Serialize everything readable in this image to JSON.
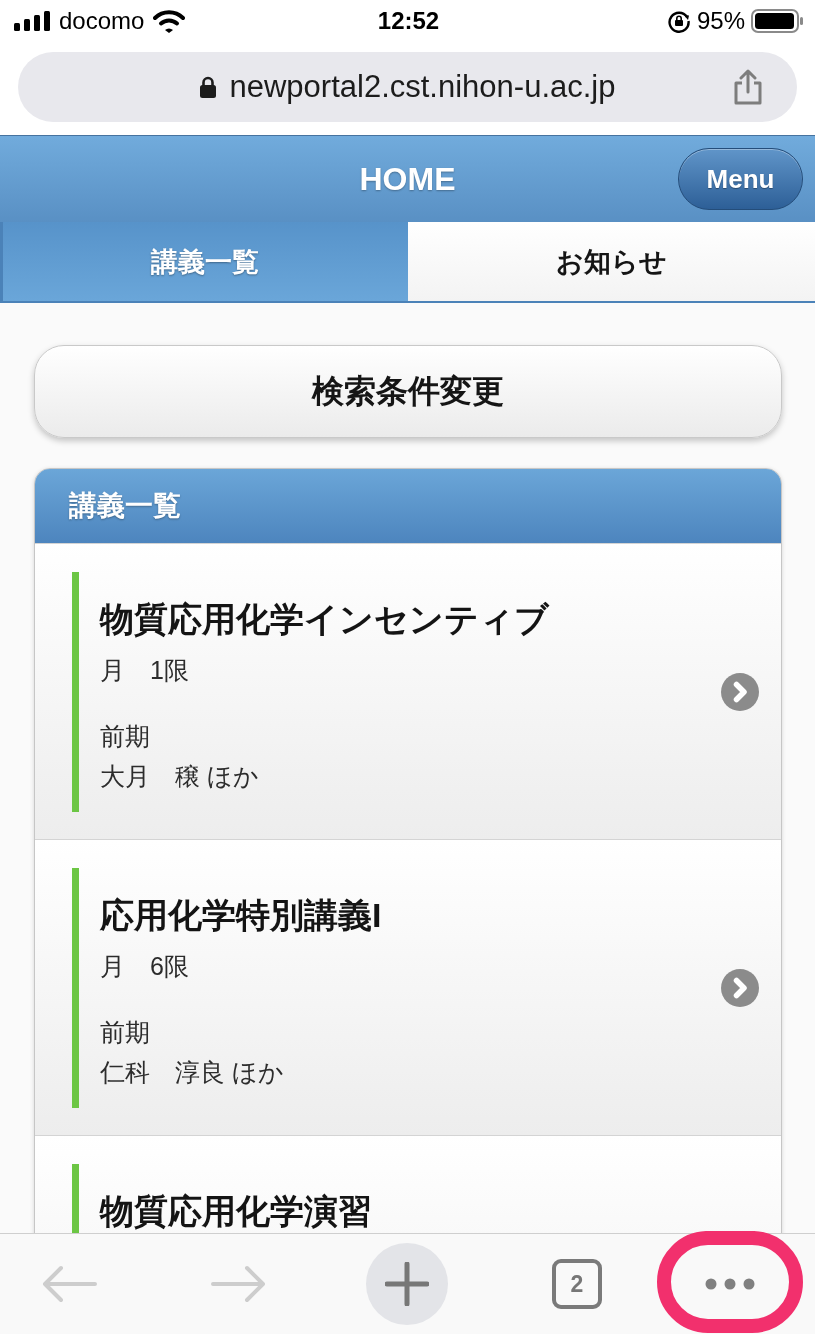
{
  "status_bar": {
    "carrier": "docomo",
    "time": "12:52",
    "battery": "95%"
  },
  "browser": {
    "url": "newportal2.cst.nihon-u.ac.jp"
  },
  "header": {
    "title": "HOME",
    "menu_button": "Menu"
  },
  "tabs": [
    {
      "label": "講義一覧",
      "selected": true
    },
    {
      "label": "お知らせ",
      "selected": false
    }
  ],
  "search_button": "検索条件変更",
  "lecture_list": {
    "title": "講義一覧",
    "items": [
      {
        "title": "物質応用化学インセンティブ",
        "schedule": "月　1限",
        "term": "前期",
        "teacher": "大月　穣 ほか"
      },
      {
        "title": "応用化学特別講義I",
        "schedule": "月　6限",
        "term": "前期",
        "teacher": "仁科　淳良 ほか"
      },
      {
        "title": "物質応用化学演習"
      }
    ]
  },
  "toolbar": {
    "back": {
      "disabled": true
    },
    "forward": {
      "disabled": true
    },
    "tab_count": "2",
    "more": {
      "highlighted": true
    }
  }
}
